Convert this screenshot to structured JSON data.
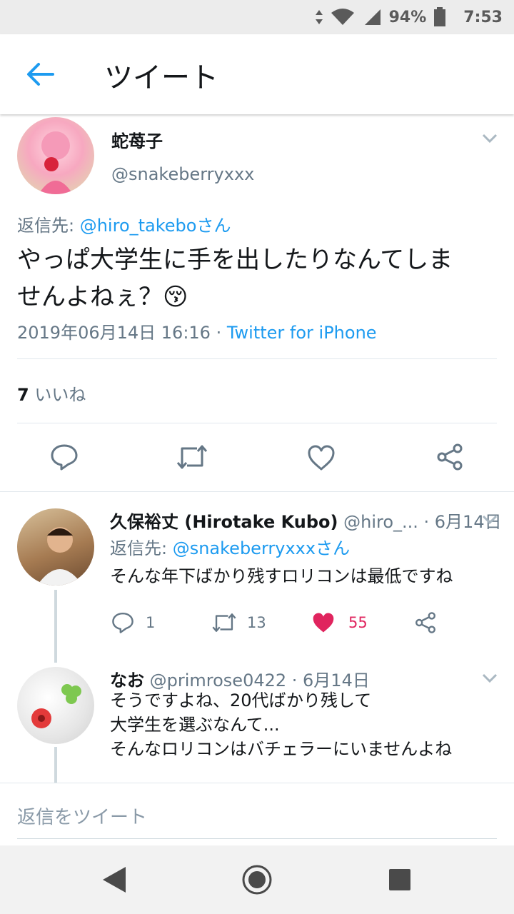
{
  "status_bar": {
    "battery": "94%",
    "time": "7:53"
  },
  "header": {
    "title": "ツイート"
  },
  "main_tweet": {
    "name": "蛇苺子",
    "handle": "@snakeberryxxx",
    "reply_prefix": "返信先: ",
    "reply_to": "@hiro_takeboさん",
    "text_line1": "やっぱ大学生に手を出したりなんてしま",
    "text_line2": "せんよねぇ？",
    "emoji": "😚",
    "timestamp": "2019年06月14日 16:16",
    "separator": " · ",
    "source": "Twitter for iPhone",
    "likes_count": "7",
    "likes_label": " いいね"
  },
  "replies": [
    {
      "name": "久保裕丈 (Hirotake Kubo)",
      "handle_date": " @hiro_... · 6月14日",
      "reply_prefix": "返信先: ",
      "reply_to": "@snakeberryxxxさん",
      "text": "そんな年下ばかり残すロリコンは最低ですね",
      "reply_count": "1",
      "retweet_count": "13",
      "like_count": "55"
    },
    {
      "name": "なお",
      "handle_date": " @primrose0422 · 6月14日",
      "text_line1": "そうですよね、20代ばかり残して",
      "text_line2": "大学生を選ぶなんて...",
      "text_line3": "そんなロリコンはバチェラーにいませんよね"
    }
  ],
  "compose": {
    "placeholder": "返信をツイート"
  },
  "colors": {
    "accent": "#1d9bf0",
    "like": "#e0245e",
    "secondary_text": "#657786"
  }
}
